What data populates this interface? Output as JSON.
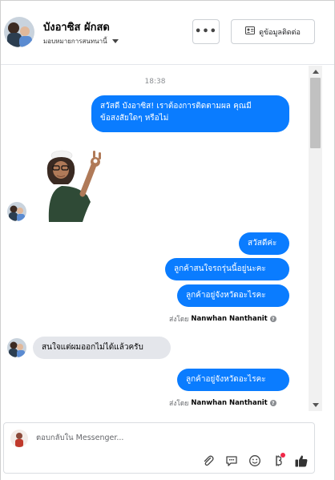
{
  "header": {
    "name": "บังอาซิส ผักสด",
    "assign_label": "มอบหมายการสนทนานี้",
    "more_label": "•••",
    "contact_label": "ดูข้อมูลติดต่อ"
  },
  "chat": {
    "time": "18:38",
    "messages": [
      {
        "side": "out",
        "text_line1": "สวัสดี บังอาซิส! เราต้องการติดตามผล คุณมี",
        "text_line2": "ข้อสงสัยใดๆ หรือไม่"
      },
      {
        "side": "out",
        "text": "สวัสดีค่ะ"
      },
      {
        "side": "out",
        "text": "ลูกค้าสนใจรถรุ่นนี้อยู่นะคะ"
      },
      {
        "side": "out",
        "text": "ลูกค้าอยู่จังหวัดอะไรคะ"
      },
      {
        "side": "in",
        "text": "สนใจแต่ผมออกไม่ได้แล้วครับ"
      },
      {
        "side": "out",
        "text": "ลูกค้าอยู่จังหวัดอะไรคะ"
      }
    ],
    "sent_by_prefix": "ส่งโดย",
    "sent_by_name": "Nanwhan Nanthanit",
    "help_icon": "?"
  },
  "composer": {
    "placeholder": "ตอบกลับใน Messenger..."
  },
  "colors": {
    "outgoing": "#0a7cff",
    "incoming": "#e4e6eb",
    "like": "#333333"
  }
}
